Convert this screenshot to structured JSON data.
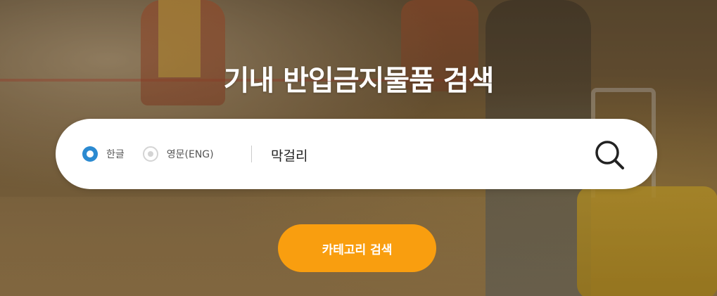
{
  "hero": {
    "title": "기내 반입금지물품 검색"
  },
  "search": {
    "language_options": [
      {
        "label": "한글",
        "selected": true
      },
      {
        "label": "영문(ENG)",
        "selected": false
      }
    ],
    "input_value": "막걸리",
    "search_icon": "search-icon"
  },
  "category_button": {
    "label": "카테고리 검색"
  },
  "colors": {
    "accent": "#f99e0f",
    "radio_selected": "#2b8ad1",
    "title_text": "#ffffff"
  }
}
